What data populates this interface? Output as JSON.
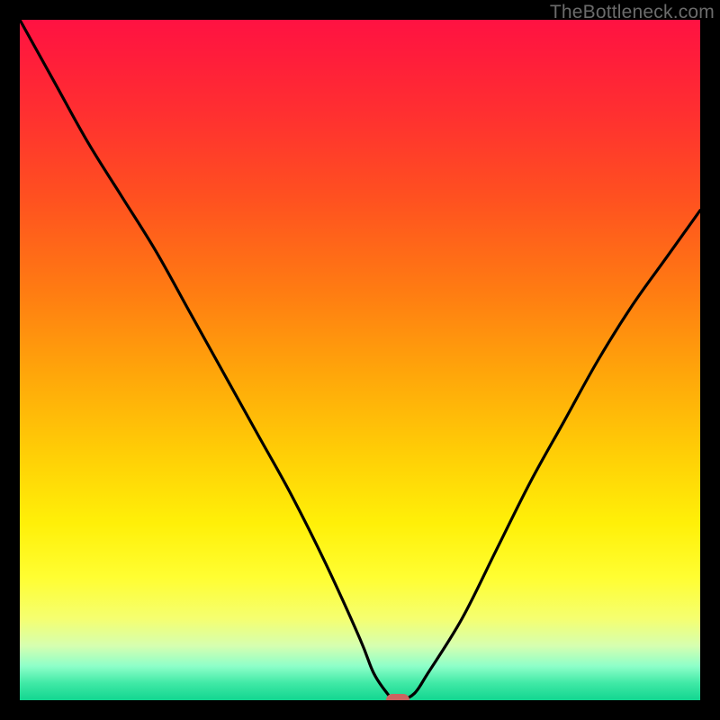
{
  "watermark": "TheBottleneck.com",
  "colors": {
    "frame": "#000000",
    "gradient_top": "#ff1242",
    "gradient_bottom": "#12d690",
    "curve": "#000000",
    "marker": "#cb6460",
    "watermark": "#6b6b6b"
  },
  "chart_data": {
    "type": "line",
    "title": "",
    "xlabel": "",
    "ylabel": "",
    "xlim": [
      0,
      100
    ],
    "ylim": [
      0,
      100
    ],
    "annotations": [],
    "series": [
      {
        "name": "bottleneck-curve",
        "x": [
          0,
          5,
          10,
          15,
          20,
          25,
          30,
          35,
          40,
          45,
          50,
          52,
          54,
          55,
          56,
          58,
          60,
          65,
          70,
          75,
          80,
          85,
          90,
          95,
          100
        ],
        "y": [
          100,
          91,
          82,
          74,
          66,
          57,
          48,
          39,
          30,
          20,
          9,
          4,
          1,
          0,
          0,
          1,
          4,
          12,
          22,
          32,
          41,
          50,
          58,
          65,
          72
        ]
      }
    ],
    "marker": {
      "x": 55.5,
      "y": 0
    },
    "background": "vertical-green-to-red-gradient"
  }
}
